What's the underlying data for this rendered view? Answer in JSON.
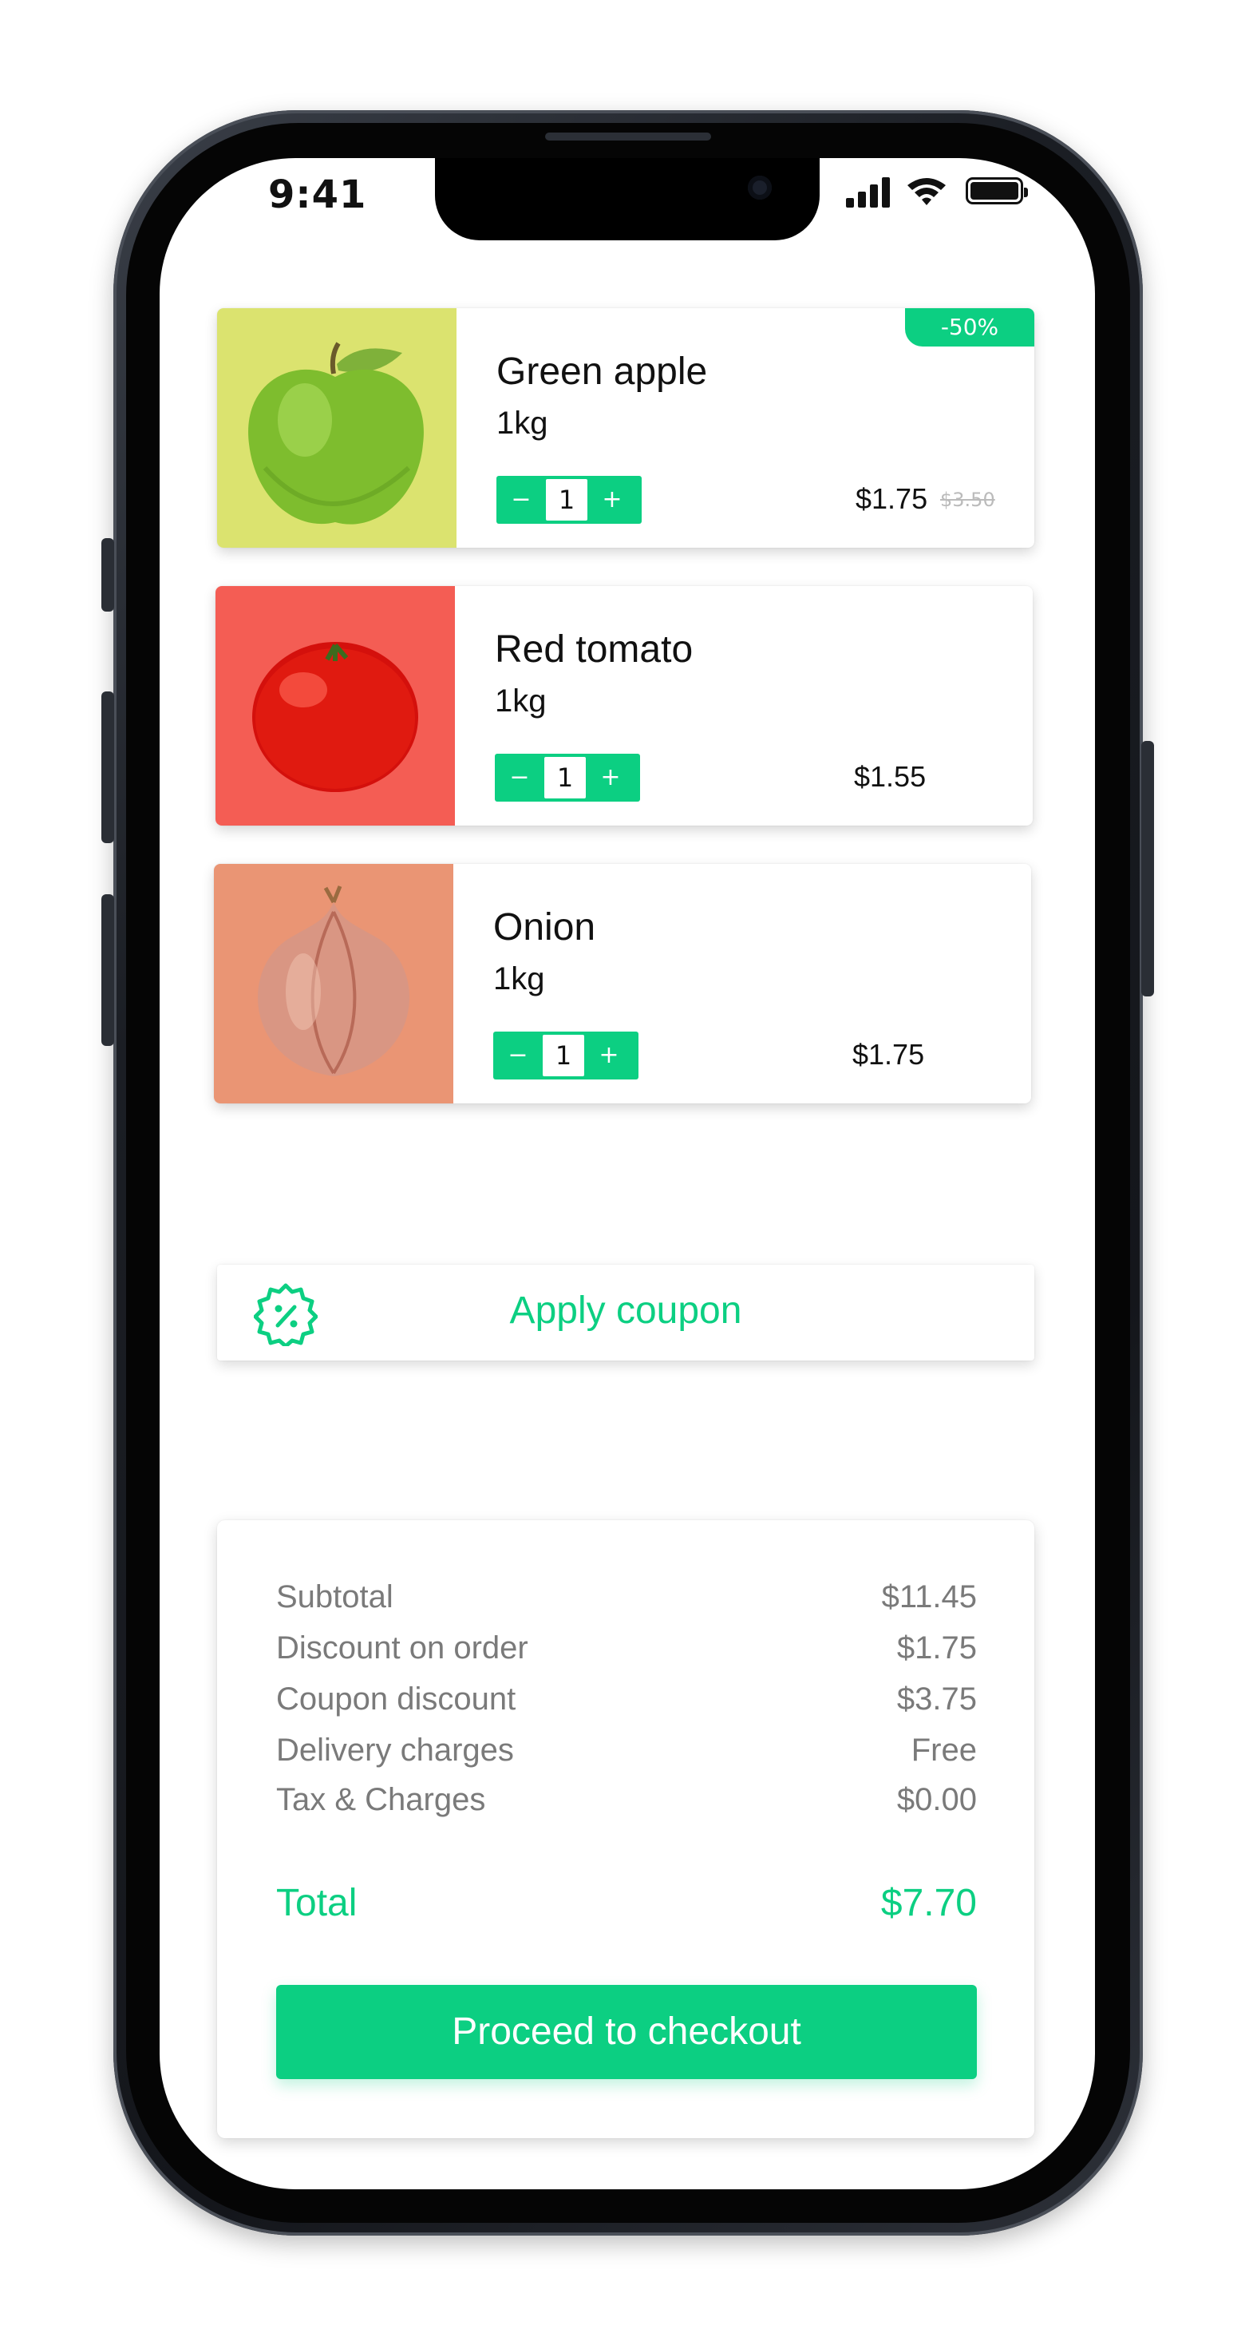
{
  "status_bar": {
    "time": "9:41"
  },
  "products": [
    {
      "name": "Green apple",
      "weight": "1kg",
      "quantity": "1",
      "price": "$1.75",
      "old_price": "$3.50",
      "badge": "-50%",
      "image": "green-apple",
      "image_bg": "#dbe36f"
    },
    {
      "name": "Red tomato",
      "weight": "1kg",
      "quantity": "1",
      "price": "$1.55",
      "image": "red-tomato",
      "image_bg": "#f45d54"
    },
    {
      "name": "Onion",
      "weight": "1kg",
      "quantity": "1",
      "price": "$1.75",
      "image": "onion",
      "image_bg": "#ea9574"
    }
  ],
  "stepper": {
    "minus": "−",
    "plus": "+"
  },
  "coupon": {
    "label": "Apply coupon",
    "icon": "discount-badge-icon"
  },
  "summary": {
    "rows": [
      {
        "label": "Subtotal",
        "value": "$11.45"
      },
      {
        "label": "Discount on order",
        "value": "$1.75"
      },
      {
        "label": "Coupon discount",
        "value": "$3.75"
      },
      {
        "label": "Delivery charges",
        "value": "Free"
      },
      {
        "label": "Tax & Charges",
        "value": "$0.00"
      }
    ],
    "total_label": "Total",
    "total_value": "$7.70",
    "checkout_label": "Proceed to checkout"
  },
  "colors": {
    "accent": "#0ccf82",
    "text": "#111111",
    "muted": "#7a7a7a"
  }
}
